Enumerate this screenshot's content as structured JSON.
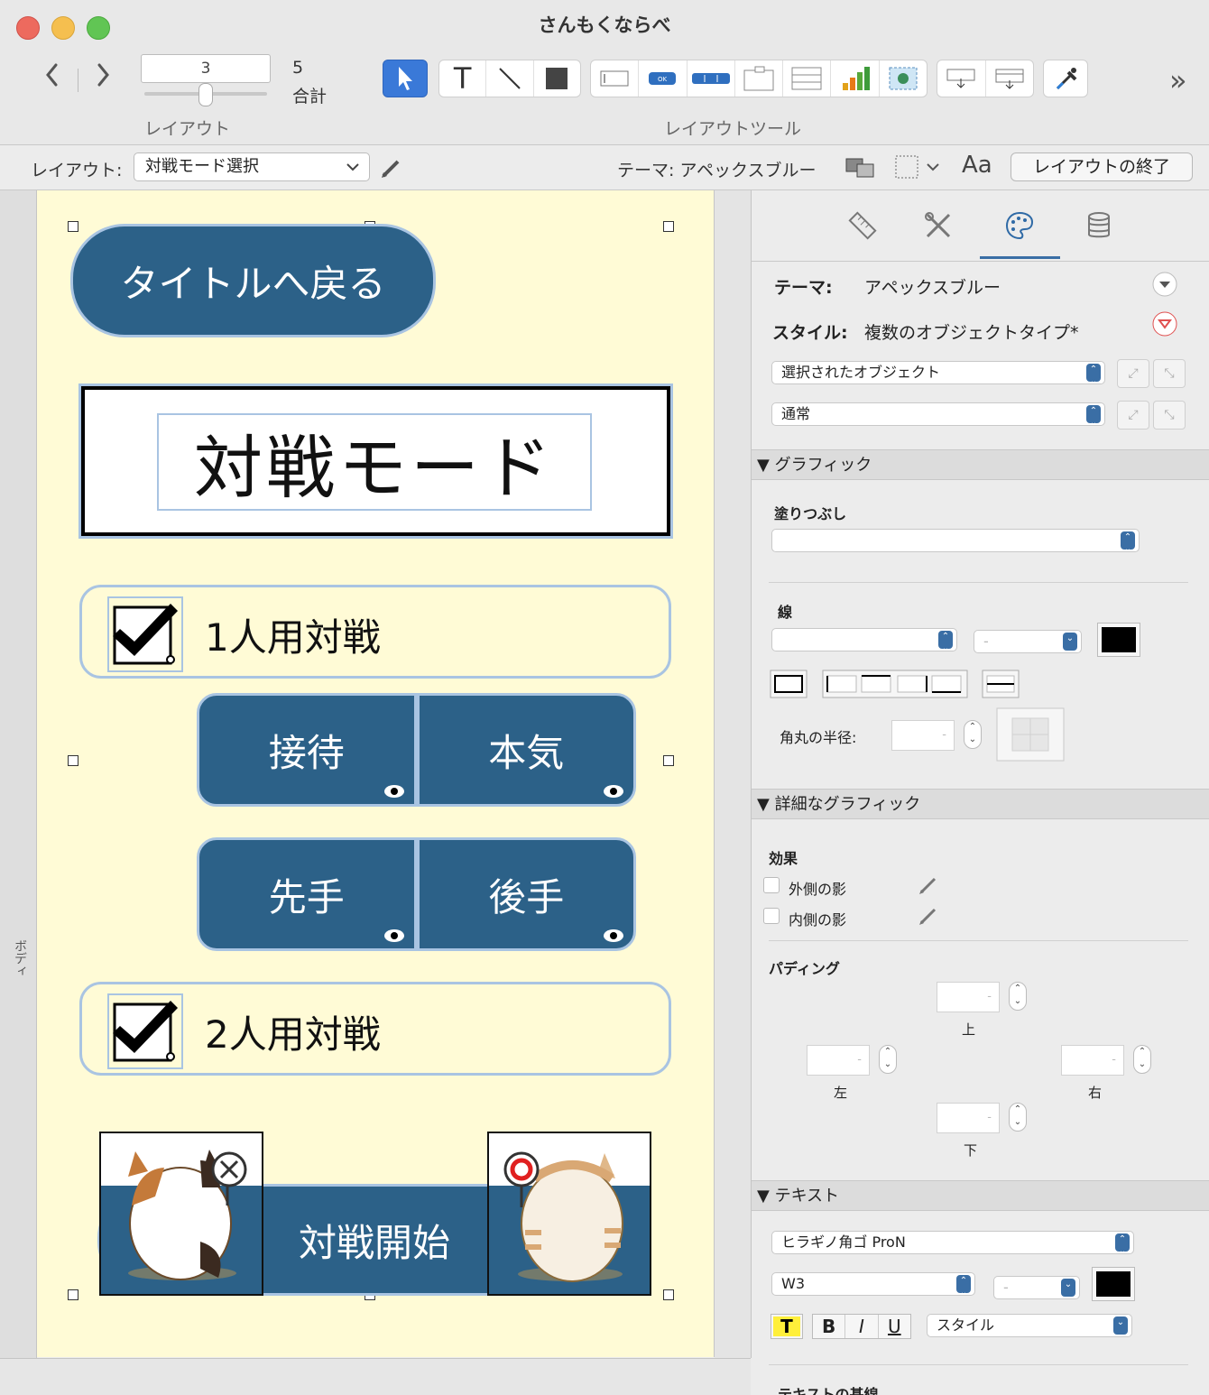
{
  "window": {
    "title": "さんもくならべ"
  },
  "toolbar": {
    "back_icon": "chevron-left-icon",
    "forward_icon": "chevron-right-icon",
    "layout_page": "3",
    "layout_total_number": "5",
    "layout_total_label": "合計",
    "layout_group_label": "レイアウト",
    "tools_group_label": "レイアウトツール",
    "text_tool_glyph": "T",
    "overflow_glyph": "»"
  },
  "layout_bar": {
    "layout_label": "レイアウト:",
    "layout_value": "対戦モード選択",
    "theme_label": "テーマ: アペックスブルー",
    "font_size_glyph": "Aa",
    "exit_button": "レイアウトの終了"
  },
  "canvas": {
    "body_tab": "ボディ",
    "back_to_title": "タイトルへ戻る",
    "banner_text": "対戦モード",
    "single_player_label": "1人用対戦",
    "difficulty": [
      "接待",
      "本気"
    ],
    "turn_order": [
      "先手",
      "後手"
    ],
    "two_player_label": "2人用対戦",
    "start_button": "対戦開始",
    "colors": {
      "background": "#fffbd6",
      "button_fill": "#2c6188",
      "selection_outline": "#a9c4e2"
    }
  },
  "inspector": {
    "tabs": [
      "ruler-icon",
      "tools-icon",
      "palette-icon",
      "database-icon"
    ],
    "theme_label": "テーマ:",
    "theme_value": "アペックスブルー",
    "style_label": "スタイル:",
    "style_value": "複数のオブジェクトタイプ*",
    "object_scope": "選択されたオブジェクト",
    "object_state": "通常",
    "graphics_section": "▼ グラフィック",
    "fill_label": "塗りつぶし",
    "line_label": "線",
    "line_width_placeholder": "-",
    "corner_radius_label": "角丸の半径:",
    "advanced_graphics_section": "▼ 詳細なグラフィック",
    "effects_label": "効果",
    "outer_shadow_label": "外側の影",
    "inner_shadow_label": "内側の影",
    "padding_label": "パディング",
    "padding_top": "上",
    "padding_left": "左",
    "padding_right": "右",
    "padding_bottom": "下",
    "field_placeholder": "-",
    "text_section": "▼ テキスト",
    "font_family": "ヒラギノ角ゴ ProN",
    "font_weight": "W3",
    "font_size_placeholder": "-",
    "text_highlight_glyph": "T",
    "bold_glyph": "B",
    "italic_glyph": "I",
    "underline_glyph": "U",
    "text_style": "スタイル",
    "text_baseline_section": "テキストの基線"
  }
}
